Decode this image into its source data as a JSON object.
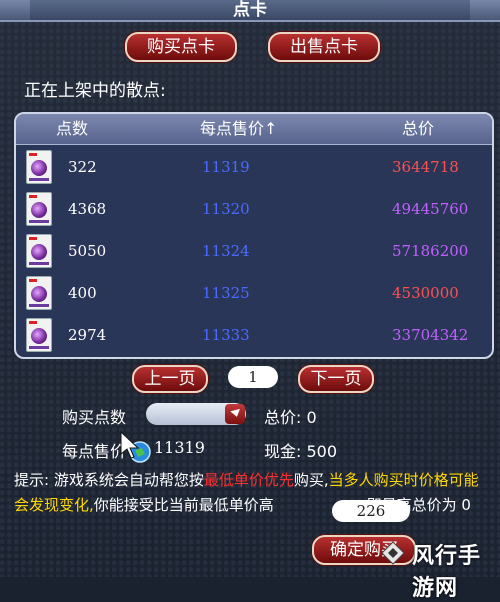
{
  "window": {
    "title": "点卡"
  },
  "tabs": {
    "buy": "购买点卡",
    "sell": "出售点卡"
  },
  "listing_heading": "正在上架中的散点:",
  "table": {
    "headers": [
      "点数",
      "每点售价↑",
      "总价"
    ],
    "rows": [
      {
        "points": "322",
        "unit_price": "11319",
        "total": "3644718",
        "total_color": "#ff5050"
      },
      {
        "points": "4368",
        "unit_price": "11320",
        "total": "49445760",
        "total_color": "#c060ff"
      },
      {
        "points": "5050",
        "unit_price": "11324",
        "total": "57186200",
        "total_color": "#c060ff"
      },
      {
        "points": "400",
        "unit_price": "11325",
        "total": "4530000",
        "total_color": "#ff5050"
      },
      {
        "points": "2974",
        "unit_price": "11333",
        "total": "33704342",
        "total_color": "#c060ff"
      }
    ]
  },
  "pager": {
    "prev": "上一页",
    "page": "1",
    "next": "下一页"
  },
  "purchase": {
    "qty_label": "购买点数",
    "total_label": "总价: 0",
    "unit_price_label": "每点售价",
    "unit_price_value": "11319",
    "cash_label": "现金: 500"
  },
  "tip": {
    "prefix": "提示: 游戏系统会自动帮您按",
    "highlight": "最低单价优先",
    "mid": "购买,",
    "warning": "当多人购买时价格可能会发现变化,",
    "accept_text": "你能接受比当前最低单价高",
    "accept_value": "226",
    "suffix": ",即最高总价为 0"
  },
  "confirm_button": "确定购买",
  "watermark": "风行手游网",
  "colors": {
    "unit_price": "#4a6bff",
    "highlight_red": "#ff3030",
    "warning_yellow": "#ffd800",
    "button_red": "#a02020"
  }
}
